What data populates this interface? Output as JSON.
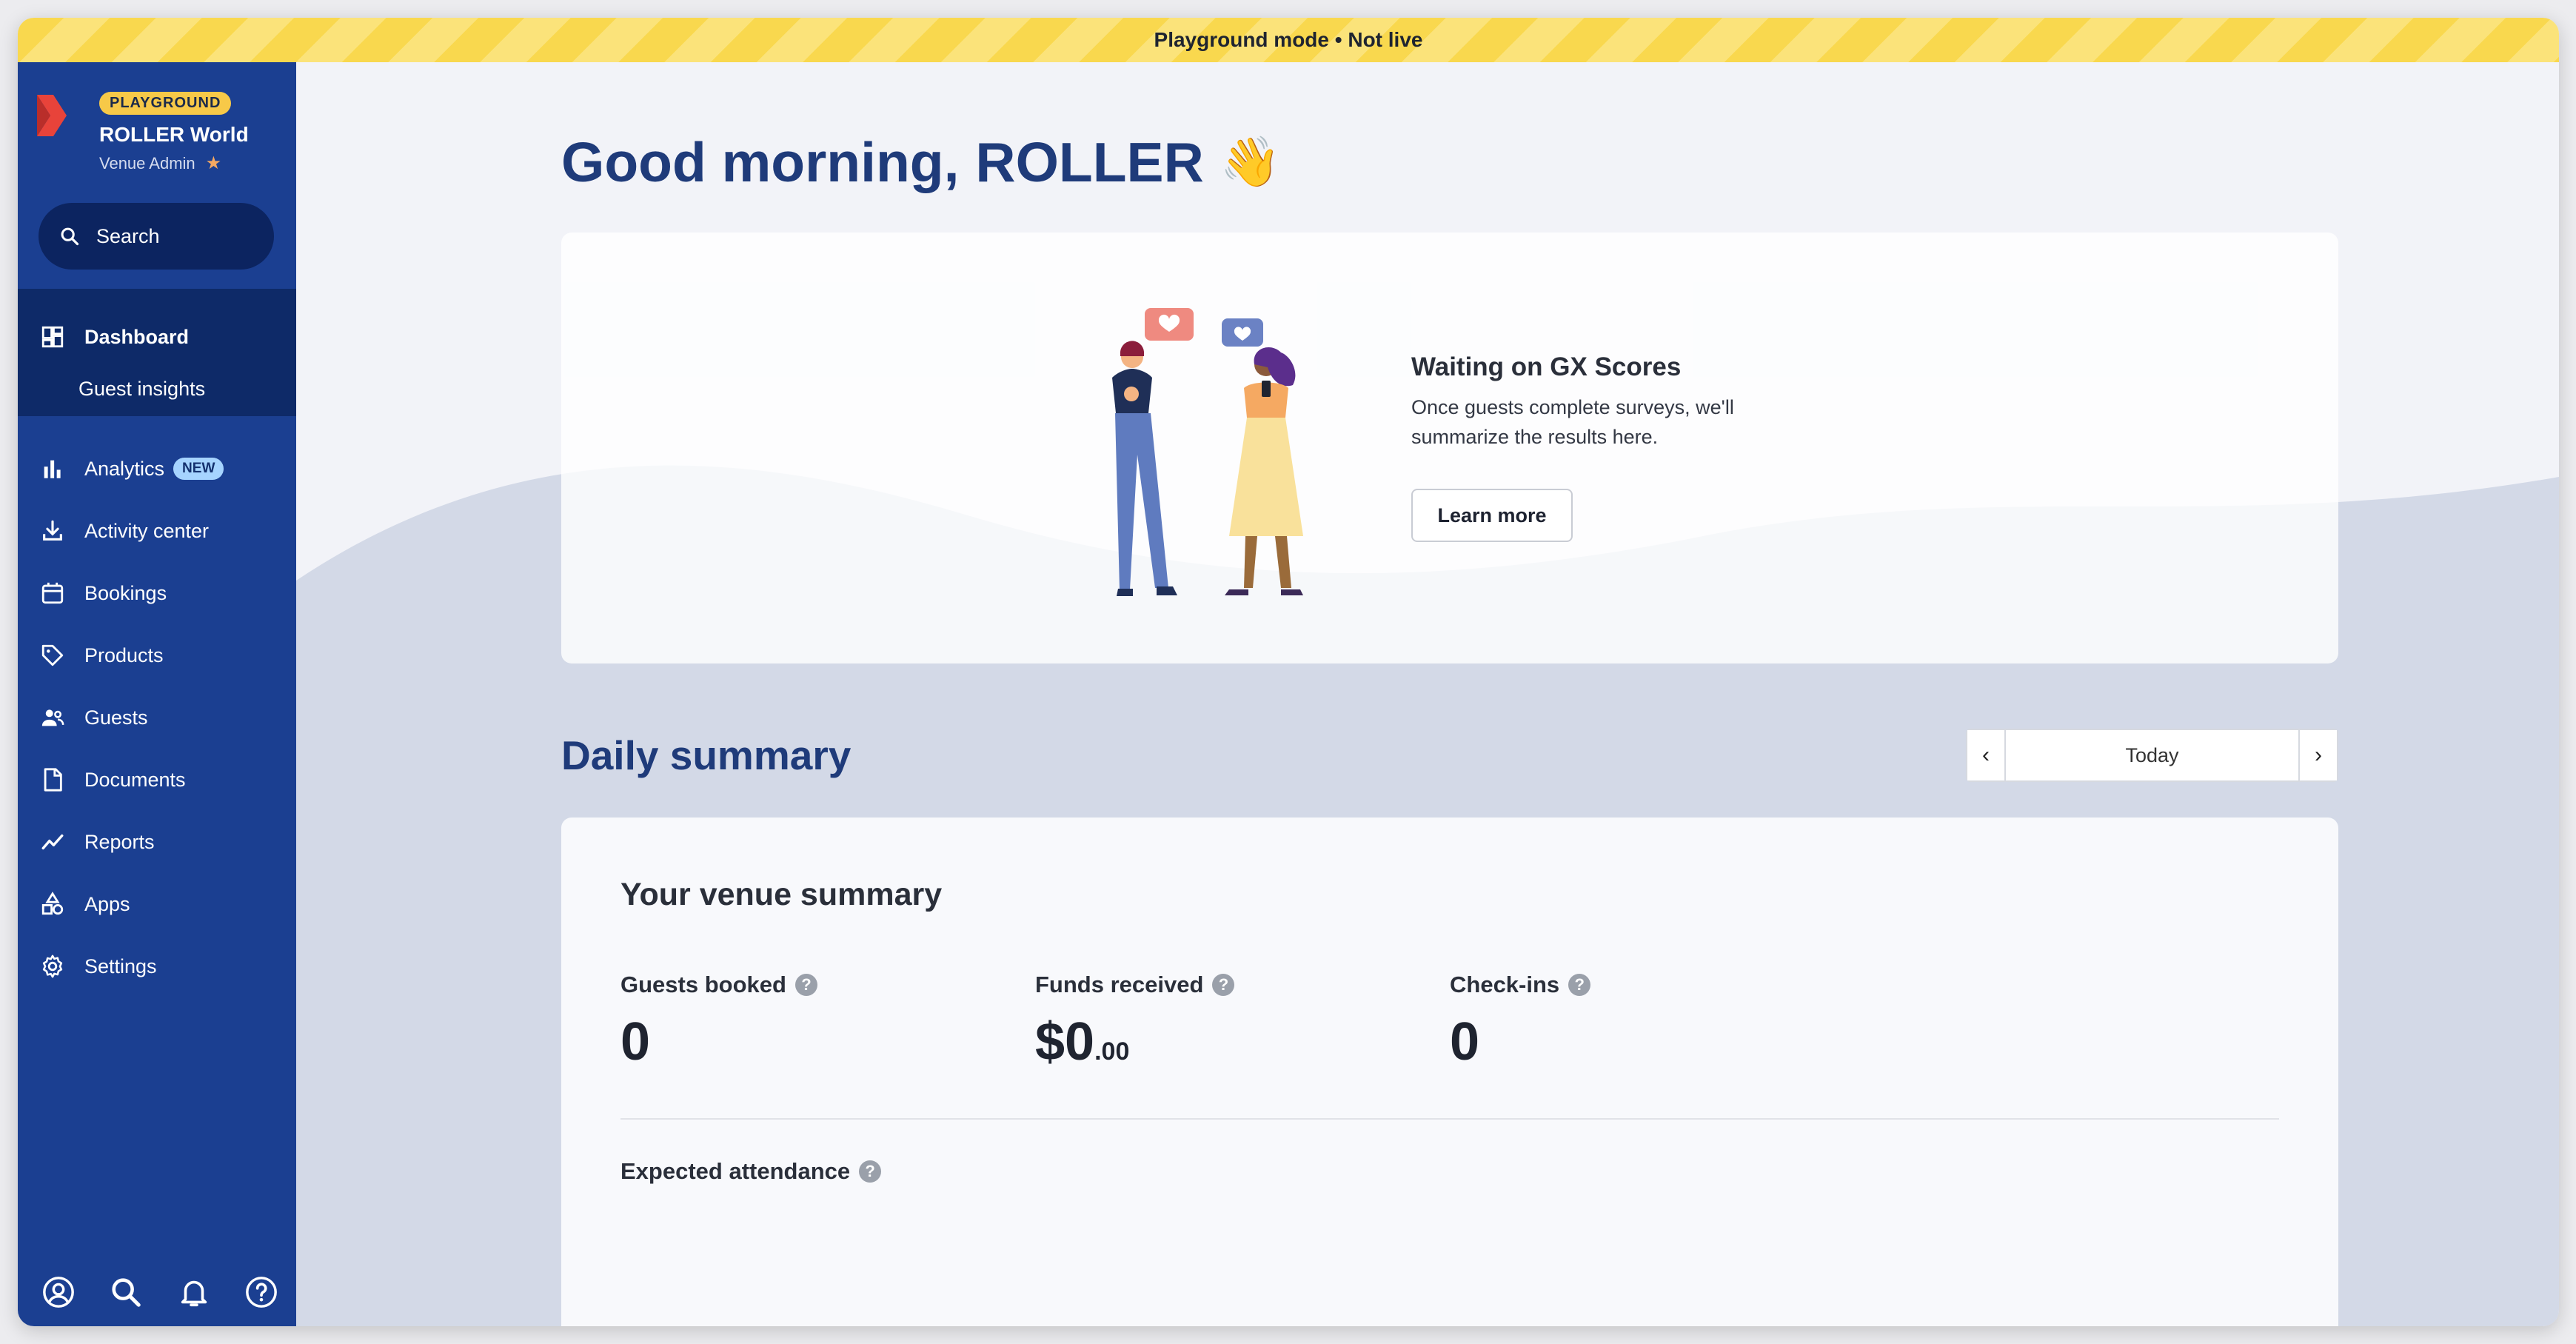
{
  "banner": {
    "text": "Playground mode • Not live"
  },
  "sidebar": {
    "badge": "PLAYGROUND",
    "venue_name": "ROLLER World",
    "venue_role": "Venue Admin",
    "search_label": "Search",
    "items": [
      {
        "label": "Dashboard",
        "icon": "dashboard-icon"
      },
      {
        "label": "Guest insights"
      },
      {
        "label": "Analytics",
        "badge": "NEW",
        "icon": "bar-chart-icon"
      },
      {
        "label": "Activity center",
        "icon": "download-tray-icon"
      },
      {
        "label": "Bookings",
        "icon": "calendar-icon"
      },
      {
        "label": "Products",
        "icon": "tag-icon"
      },
      {
        "label": "Guests",
        "icon": "people-icon"
      },
      {
        "label": "Documents",
        "icon": "document-icon"
      },
      {
        "label": "Reports",
        "icon": "trend-line-icon"
      },
      {
        "label": "Apps",
        "icon": "shapes-icon"
      },
      {
        "label": "Settings",
        "icon": "gear-icon"
      }
    ],
    "bottom_icons": [
      "account-icon",
      "search-icon",
      "bell-icon",
      "help-icon"
    ]
  },
  "main": {
    "greeting": "Good morning,",
    "user_name": "ROLLER",
    "gx_card": {
      "title": "Waiting on GX Scores",
      "text": "Once guests complete surveys, we'll summarize the results here.",
      "button": "Learn more"
    },
    "daily_summary": {
      "title": "Daily summary",
      "date_label": "Today",
      "card_title": "Your venue summary",
      "metrics": [
        {
          "label": "Guests booked",
          "value": "0"
        },
        {
          "label": "Funds received",
          "value": "$0",
          "cents": ".00"
        },
        {
          "label": "Check-ins",
          "value": "0"
        }
      ],
      "expected_attendance": "Expected attendance"
    }
  },
  "colors": {
    "sidebar": "#1b3f91",
    "sidebar_active": "#0e2a68",
    "heading": "#1f3b7a",
    "banner": "#f9d84e"
  }
}
